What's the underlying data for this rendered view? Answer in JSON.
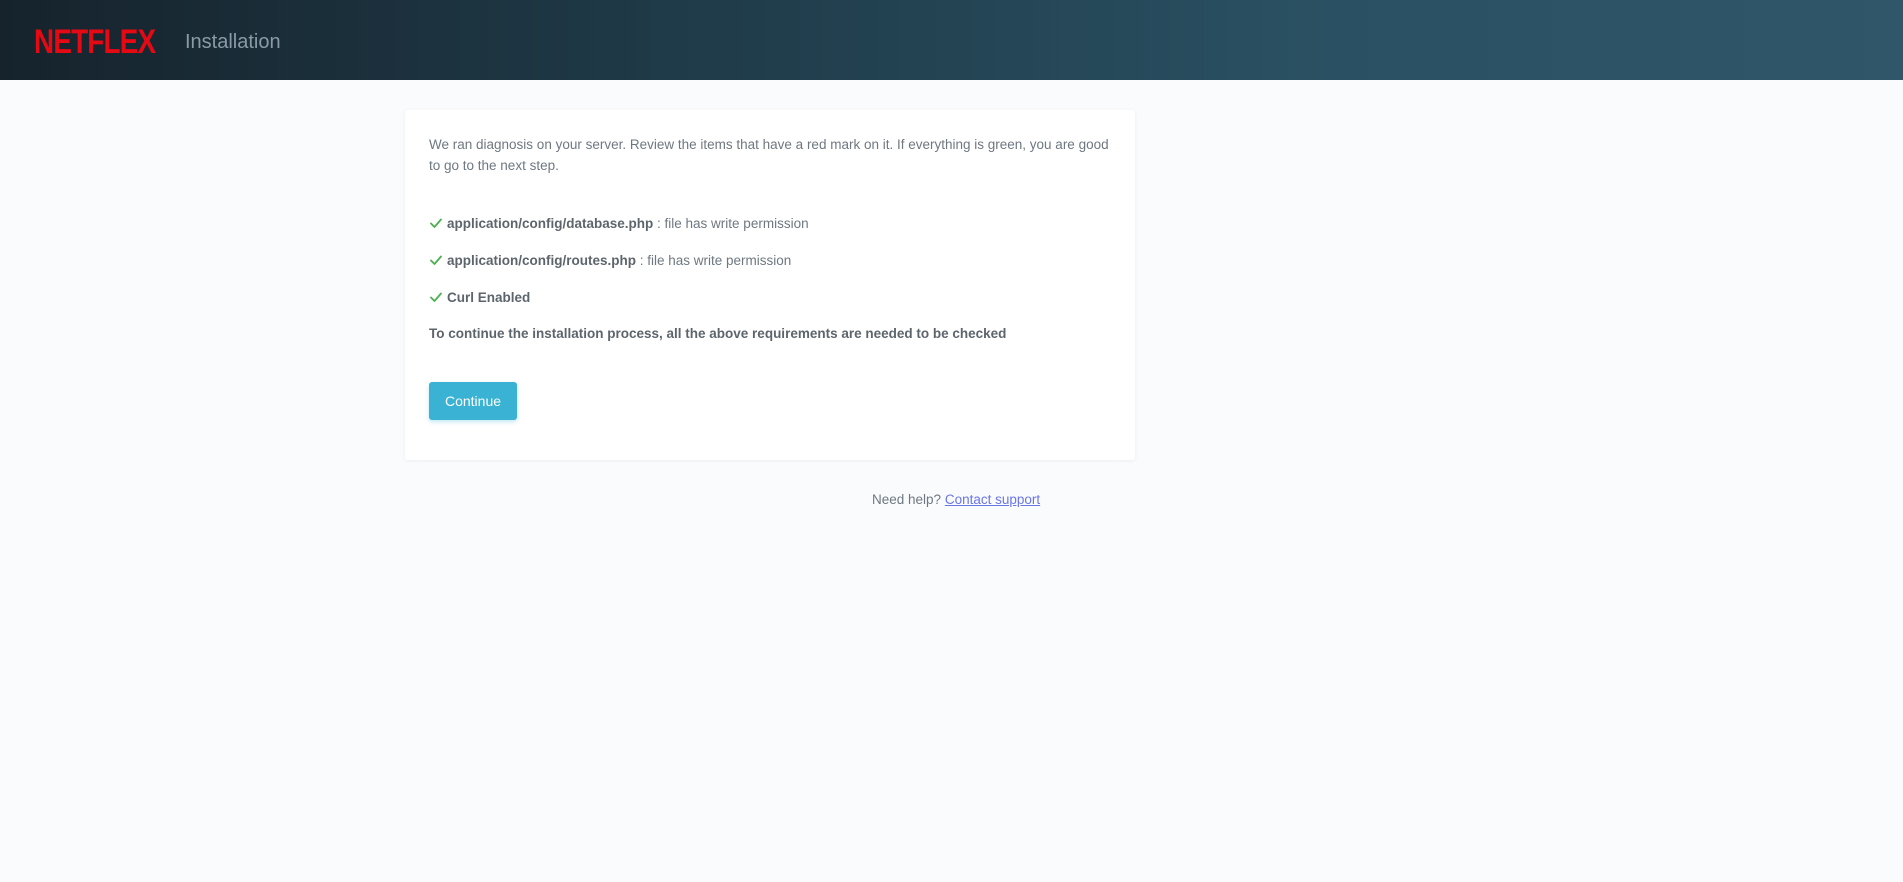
{
  "header": {
    "logo_text": "NETFLEX",
    "title": "Installation",
    "logo_color": "#e50914"
  },
  "card": {
    "intro": "We ran diagnosis on your server. Review the items that have a red mark on it. If everything is green, you are good to go to the next step.",
    "checks": [
      {
        "icon": "check-icon",
        "status": "ok",
        "label": "application/config/database.php",
        "detail": " : file has write permission"
      },
      {
        "icon": "check-icon",
        "status": "ok",
        "label": "application/config/routes.php",
        "detail": " : file has write permission"
      },
      {
        "icon": "check-icon",
        "status": "ok",
        "label": "Curl Enabled",
        "detail": ""
      }
    ],
    "requirement_note": "To continue the installation process, all the above requirements are needed to be checked",
    "continue_label": "Continue"
  },
  "help": {
    "text": "Need help?",
    "link_label": "Contact support"
  },
  "colors": {
    "accent": "#39b2d3",
    "check": "#4caf50",
    "link": "#6b76e6"
  }
}
